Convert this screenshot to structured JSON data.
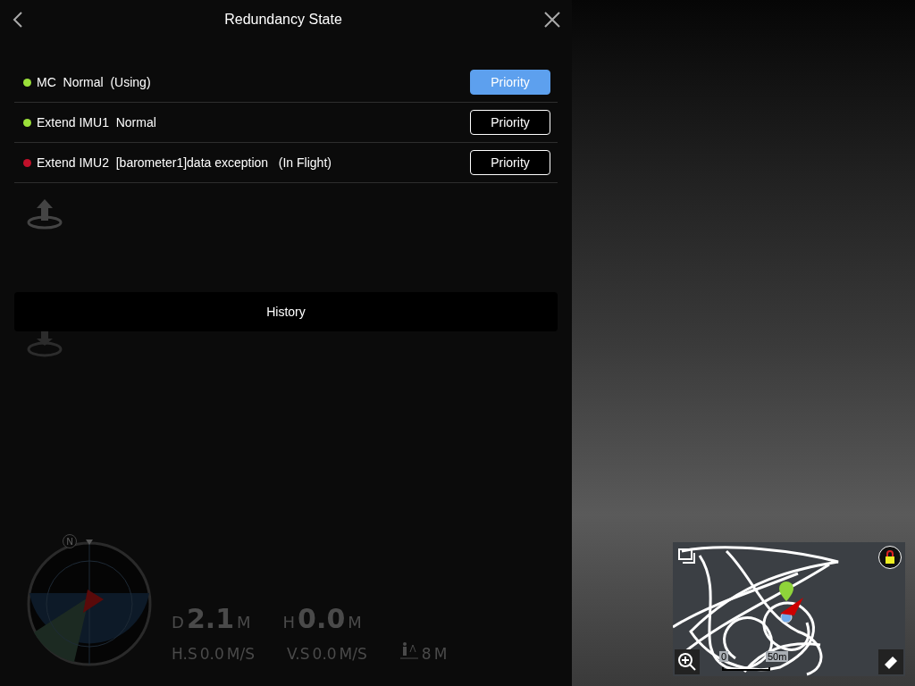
{
  "header": {
    "title": "Redundancy State"
  },
  "modules": [
    {
      "text": "MC  Normal  (Using)",
      "color": "#9be03a",
      "button": "Priority",
      "selected": true
    },
    {
      "text": "Extend IMU1  Normal",
      "color": "#9be03a",
      "button": "Priority",
      "selected": false
    },
    {
      "text": "Extend IMU2  [barometer1]data exception   (In Flight)",
      "color": "#c0102a",
      "button": "Priority",
      "selected": false
    }
  ],
  "history_button": "History",
  "compass": {
    "north": "N"
  },
  "telemetry": {
    "primary": [
      {
        "label": "D",
        "value": "2.1",
        "unit": "M"
      },
      {
        "label": "H",
        "value": "0.0",
        "unit": "M"
      }
    ],
    "secondary": [
      {
        "kind": "labeled",
        "label": "H.S",
        "value": "0.0",
        "unit": "M/S"
      },
      {
        "kind": "labeled",
        "label": "V.S",
        "value": "0.0",
        "unit": "M/S"
      },
      {
        "kind": "person",
        "value": "8",
        "unit": "M"
      }
    ]
  },
  "map": {
    "scale_start": "0",
    "scale_end": "50m"
  }
}
